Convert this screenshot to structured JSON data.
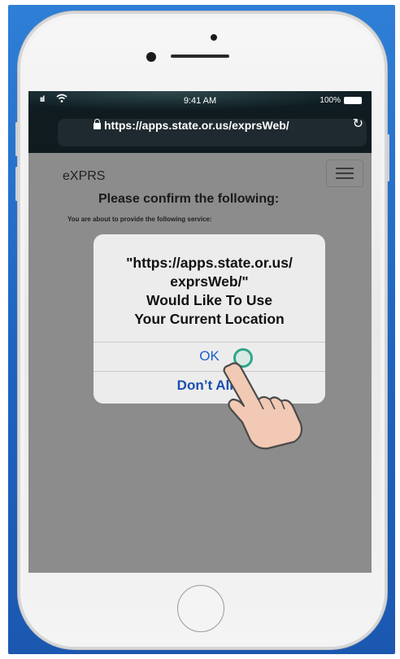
{
  "status_bar": {
    "signal": "ııl",
    "time": "9:41 AM",
    "battery": "100%"
  },
  "browser": {
    "url": "https://apps.state.or.us/exprsWeb/"
  },
  "web": {
    "brand": "eXPRS",
    "title": "Please confirm the following:",
    "subtitle": "You are about to provide the following service:"
  },
  "dialog": {
    "line1": "\"https://apps.state.or.us/",
    "line2": "exprsWeb/\"",
    "line3": "Would Like To Use",
    "line4": "Your Current Location",
    "ok_label": "OK",
    "deny_label": "Don’t Allo"
  },
  "colors": {
    "frame_blue": "#1e63c1",
    "dialog_link": "#1a5fd0",
    "tap_ring": "#2fa68a"
  }
}
